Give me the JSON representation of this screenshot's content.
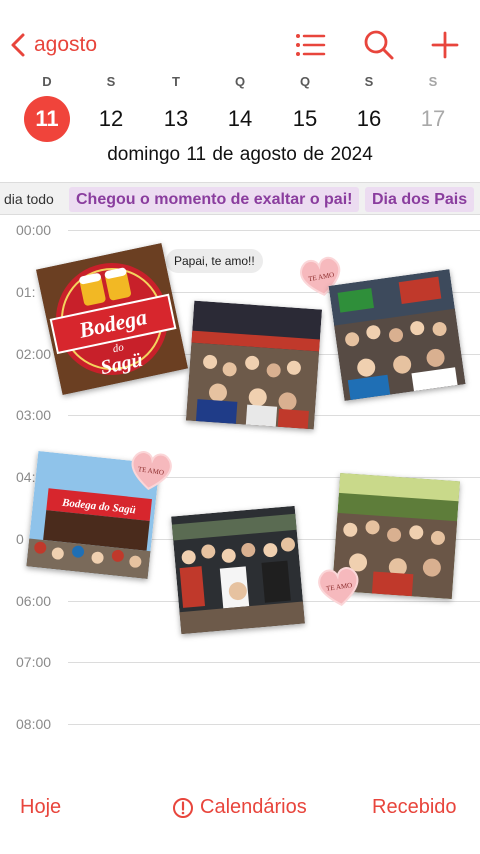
{
  "nav": {
    "back_label": "agosto",
    "icons": [
      "chevron-left-icon",
      "list-icon",
      "search-icon",
      "plus-icon"
    ],
    "accent": "#e8453c"
  },
  "week": {
    "weekday_initials": [
      "D",
      "S",
      "T",
      "Q",
      "Q",
      "S",
      "S"
    ],
    "dates": [
      "11",
      "12",
      "13",
      "14",
      "15",
      "16",
      "17"
    ],
    "selected": "11",
    "selected_color": "#f0443b"
  },
  "full_date": "domingo  11 de agosto de 2024",
  "all_day": {
    "label": "dia todo",
    "events": [
      "Chegou o momento de exaltar o pai!",
      "Dia dos Pais"
    ],
    "event_bg": "#ecdcf1",
    "event_color": "#8a3d9e"
  },
  "hours": [
    "00:00",
    "01:",
    "02:00",
    "03:00",
    "04:",
    "0",
    "06:00",
    "07:00",
    "08:00"
  ],
  "overlay": {
    "logo_text": "Bodega",
    "logo_sub": "do",
    "logo_text2": "Sagü",
    "storefront_sign": "Bodega do Sagü",
    "bubble": "Papai, te amo!!",
    "heart_label": "TE AMO"
  },
  "tabbar": {
    "today": "Hoje",
    "calendars": "Calendários",
    "inbox": "Recebido"
  }
}
